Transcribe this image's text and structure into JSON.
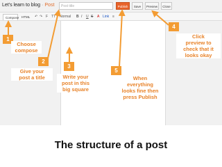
{
  "screenshot": {
    "blog_name": "Let's learn to blog",
    "post_word": "Post",
    "title_placeholder": "Post title",
    "buttons": {
      "publish": "Publish",
      "save": "Save",
      "preview": "Preview",
      "close": "Close"
    },
    "tabs": {
      "compose": "Compose",
      "html": "HTML"
    },
    "toolbar": {
      "undo": "↶",
      "redo": "↷",
      "format": "F",
      "font_size": "TT",
      "normal": "Normal",
      "bold": "B",
      "italic": "I",
      "underline": "U",
      "strike": "S",
      "text_color": "A",
      "link": "Link",
      "align": "≡"
    }
  },
  "annotations": [
    {
      "num": "1",
      "text": [
        "Choose",
        "compose"
      ]
    },
    {
      "num": "2",
      "text": [
        "Give your",
        "post a title"
      ]
    },
    {
      "num": "3",
      "text": [
        "Write your",
        "post in this",
        "big square"
      ]
    },
    {
      "num": "4",
      "text": [
        "Click",
        "preview to",
        "check that it",
        "looks okay"
      ]
    },
    {
      "num": "5",
      "text": [
        "When",
        "everything",
        "looks fine then",
        "press Publish"
      ]
    }
  ],
  "footer_title": "The structure of a post",
  "colors": {
    "accent": "#f39c33",
    "note_text": "#e8832a",
    "publish": "#e8632a"
  }
}
